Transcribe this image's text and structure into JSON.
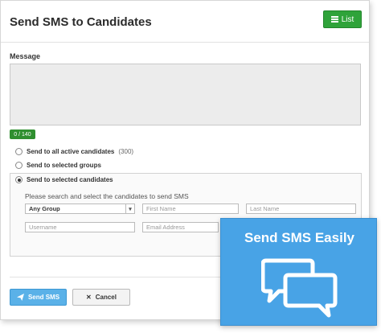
{
  "header": {
    "title": "Send SMS to Candidates",
    "list_button_label": "List",
    "list_icon": "list-icon"
  },
  "message": {
    "label": "Message",
    "value": "",
    "counter": "0 / 140"
  },
  "recipients": {
    "options": [
      {
        "label": "Send to all active candidates",
        "note": "(300)",
        "selected": false
      },
      {
        "label": "Send to selected groups",
        "note": "",
        "selected": false
      },
      {
        "label": "Send to selected candidates",
        "note": "",
        "selected": true
      }
    ],
    "search_hint": "Please search and select the candidates to send SMS",
    "group_select_value": "Any Group",
    "first_name_placeholder": "First Name",
    "last_name_placeholder": "Last Name",
    "username_placeholder": "Username",
    "email_placeholder": "Email Address"
  },
  "actions": {
    "send_label": "Send SMS",
    "send_icon": "paper-plane-icon",
    "cancel_label": "Cancel",
    "cancel_icon": "close-icon"
  },
  "promo": {
    "title": "Send SMS Easily",
    "icon": "chat-bubbles-icon",
    "background_color": "#48a3e6"
  },
  "colors": {
    "list_button": "#2fa33a",
    "counter_badge": "#2f8f2f",
    "send_button": "#5ab1e8"
  }
}
